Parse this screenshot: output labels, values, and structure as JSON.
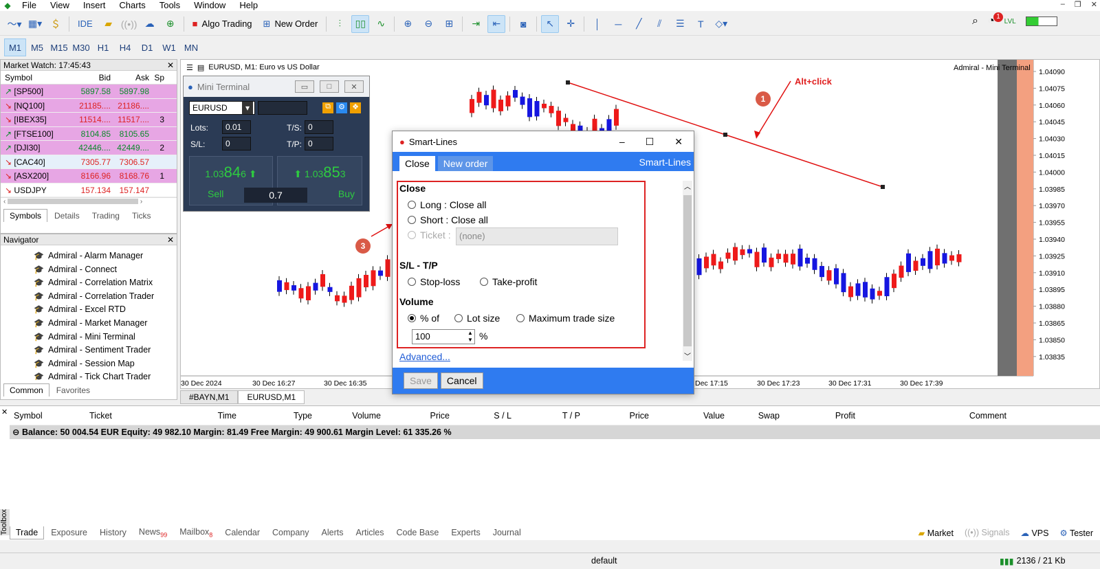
{
  "menu": [
    "File",
    "View",
    "Insert",
    "Charts",
    "Tools",
    "Window",
    "Help"
  ],
  "toolbar": {
    "ide": "IDE",
    "algo": "Algo Trading",
    "new_order": "New Order"
  },
  "timeframes": [
    "M1",
    "M5",
    "M15",
    "M30",
    "H1",
    "H4",
    "D1",
    "W1",
    "MN"
  ],
  "market_watch": {
    "title": "Market Watch: 17:45:43",
    "cols": [
      "Symbol",
      "Bid",
      "Ask",
      "Sp"
    ],
    "rows": [
      {
        "s": "[SP500]",
        "b": "5897.58",
        "a": "5897.98",
        "sp": "",
        "dir": "up",
        "hl": "#e7a6e4"
      },
      {
        "s": "[NQ100]",
        "b": "21185....",
        "a": "21186....",
        "sp": "",
        "dir": "dn",
        "hl": "#e7a6e4"
      },
      {
        "s": "[IBEX35]",
        "b": "11514....",
        "a": "11517....",
        "sp": "3",
        "dir": "dn",
        "hl": "#e7a6e4"
      },
      {
        "s": "[FTSE100]",
        "b": "8104.85",
        "a": "8105.65",
        "sp": "",
        "dir": "up",
        "hl": "#e7a6e4"
      },
      {
        "s": "[DJI30]",
        "b": "42446....",
        "a": "42449....",
        "sp": "2",
        "dir": "up",
        "hl": "#e7a6e4"
      },
      {
        "s": "[CAC40]",
        "b": "7305.77",
        "a": "7306.57",
        "sp": "",
        "dir": "dn",
        "hl": "#e6f0fa"
      },
      {
        "s": "[ASX200]",
        "b": "8166.96",
        "a": "8168.76",
        "sp": "1",
        "dir": "dn",
        "hl": "#e7a6e4"
      },
      {
        "s": "USDJPY",
        "b": "157.134",
        "a": "157.147",
        "sp": "",
        "dir": "dn",
        "hl": "#ffffff"
      }
    ],
    "tabs": [
      "Symbols",
      "Details",
      "Trading",
      "Ticks"
    ]
  },
  "navigator": {
    "title": "Navigator",
    "items": [
      "Admiral - Alarm Manager",
      "Admiral - Connect",
      "Admiral - Correlation Matrix",
      "Admiral - Correlation Trader",
      "Admiral - Excel RTD",
      "Admiral - Market Manager",
      "Admiral - Mini Terminal",
      "Admiral - Sentiment Trader",
      "Admiral - Session Map",
      "Admiral - Tick Chart Trader",
      "Admiral - Trade Terminal"
    ],
    "tabs": [
      "Common",
      "Favorites"
    ]
  },
  "chart": {
    "header": "EURUSD, M1:  Euro vs US Dollar",
    "corner": "Admiral - Mini Terminal",
    "price_ticks": [
      "1.04090",
      "1.04075",
      "1.04060",
      "1.04045",
      "1.04030",
      "1.04015",
      "1.04000",
      "1.03985",
      "1.03970",
      "1.03955",
      "1.03940",
      "1.03925",
      "1.03910",
      "1.03895",
      "1.03880",
      "1.03865",
      "1.03850",
      "1.03835"
    ],
    "time_ticks": [
      "30 Dec 2024",
      "30 Dec 16:27",
      "30 Dec 16:35",
      "Dec 17:15",
      "30 Dec 17:23",
      "30 Dec 17:31",
      "30 Dec 17:39"
    ],
    "tabs": [
      "#BAYN,M1",
      "EURUSD,M1"
    ]
  },
  "mini_terminal": {
    "title": "Mini Terminal",
    "symbol": "EURUSD",
    "lots_label": "Lots:",
    "lots": "0.01",
    "sl_label": "S/L:",
    "sl": "0",
    "ts_label": "T/S:",
    "ts": "0",
    "tp_label": "T/P:",
    "tp": "0",
    "sell_small": "1.03",
    "sell_big": "84",
    "sell_sup": "6",
    "buy_small": "1.03",
    "buy_big": "85",
    "buy_sup": "3",
    "sell": "Sell",
    "buy": "Buy",
    "spread": "0.7"
  },
  "smart_lines": {
    "title": "Smart-Lines",
    "tabs": [
      "Close",
      "New order"
    ],
    "brand": "Smart-Lines",
    "close_header": "Close",
    "long": "Long : Close all",
    "short": "Short : Close all",
    "ticket_label": "Ticket :",
    "ticket_value": "(none)",
    "sltp_header": "S/L - T/P",
    "stop_loss": "Stop-loss",
    "take_profit": "Take-profit",
    "volume_header": "Volume",
    "vol_pct": "% of",
    "vol_lot": "Lot size",
    "vol_max": "Maximum trade size",
    "volume_value": "100",
    "volume_unit": "%",
    "advanced": "Advanced...",
    "save": "Save",
    "cancel": "Cancel"
  },
  "annotations": {
    "alt_click": "Alt+click",
    "n1": "1",
    "n2": "2",
    "n3": "3"
  },
  "terminal": {
    "cols": [
      "Symbol",
      "Ticket",
      "Time",
      "Type",
      "Volume",
      "Price",
      "S / L",
      "T / P",
      "Price",
      "Value",
      "Swap",
      "Profit",
      "Comment"
    ],
    "balance": "Balance: 50 004.54 EUR  Equity: 49 982.10  Margin: 81.49  Free Margin: 49 900.61  Margin Level: 61 335.26 %",
    "tabs": [
      "Trade",
      "Exposure",
      "History",
      "News",
      "Mailbox",
      "Calendar",
      "Company",
      "Alerts",
      "Articles",
      "Code Base",
      "Experts",
      "Journal"
    ],
    "news_count": "99",
    "mail_count": "8",
    "right_tabs": [
      "Market",
      "Signals",
      "VPS",
      "Tester"
    ],
    "toolbox": "Toolbox"
  },
  "status": {
    "profile": "default",
    "traffic": "2136 / 21 Kb"
  },
  "notif_count": "1"
}
